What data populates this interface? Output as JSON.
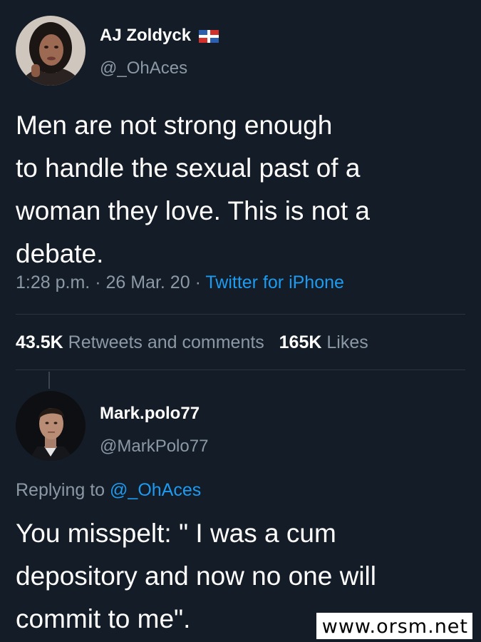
{
  "tweet": {
    "author_name": "AJ Zoldyck",
    "author_flag_icon": "dominican-flag-icon",
    "author_handle": "@_OhAces",
    "text_lines": [
      "Men are not strong enough",
      "to handle the sexual past of a",
      "woman they love. This is not a",
      "debate."
    ],
    "time": "1:28 p.m.",
    "separator": "·",
    "date": "26 Mar. 20",
    "source": "Twitter for iPhone",
    "retweets_count": "43.5K",
    "retweets_label": "Retweets and comments",
    "likes_count": "165K",
    "likes_label": "Likes"
  },
  "reply": {
    "author_name": "Mark.polo77",
    "author_handle": "@MarkPolo77",
    "replying_label": "Replying to",
    "replying_mention": "@_OhAces",
    "text_lines": [
      "You misspelt: \" I was a cum",
      "depository and now no one will",
      "commit to me\"."
    ]
  },
  "watermark": "www.orsm.net",
  "colors": {
    "background": "#141c27",
    "text": "#ffffff",
    "muted": "#8b98a5",
    "link": "#1d9bf0",
    "divider": "#2b3541"
  }
}
